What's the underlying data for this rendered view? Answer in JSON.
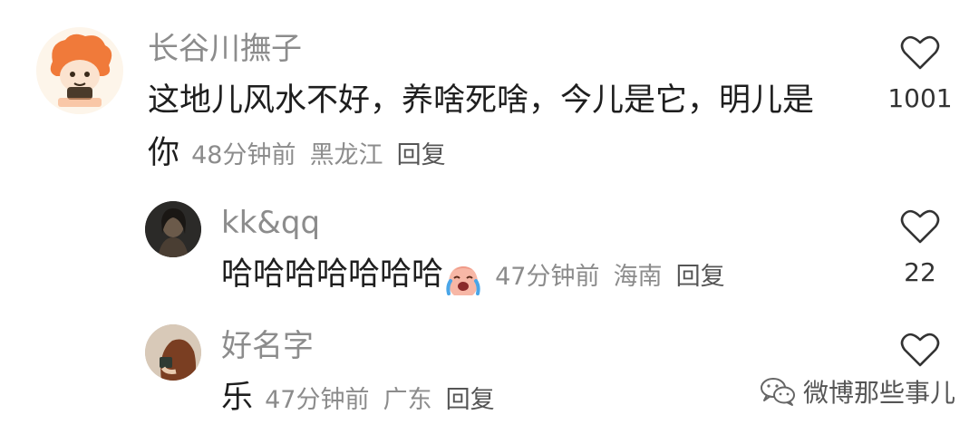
{
  "comments": [
    {
      "username": "长谷川撫子",
      "text_line1": "这地儿风水不好，养啥死啥，今儿是它，明儿是",
      "text_line2": "你",
      "time": "48分钟前",
      "location": "黑龙江",
      "reply_label": "回复",
      "likes": "1001"
    },
    {
      "username": "kk&qq",
      "text": "哈哈哈哈哈哈哈",
      "emoji": "crying-laughing-face",
      "time": "47分钟前",
      "location": "海南",
      "reply_label": "回复",
      "likes": "22"
    },
    {
      "username": "好名字",
      "text": "乐",
      "time": "47分钟前",
      "location": "广东",
      "reply_label": "回复",
      "likes": ""
    }
  ],
  "watermark": {
    "icon": "wechat-icon",
    "text": "微博那些事儿"
  },
  "colors": {
    "username": "#8c8c8c",
    "text": "#1e1e1e",
    "avatar1_hair": "#f07a3a"
  }
}
